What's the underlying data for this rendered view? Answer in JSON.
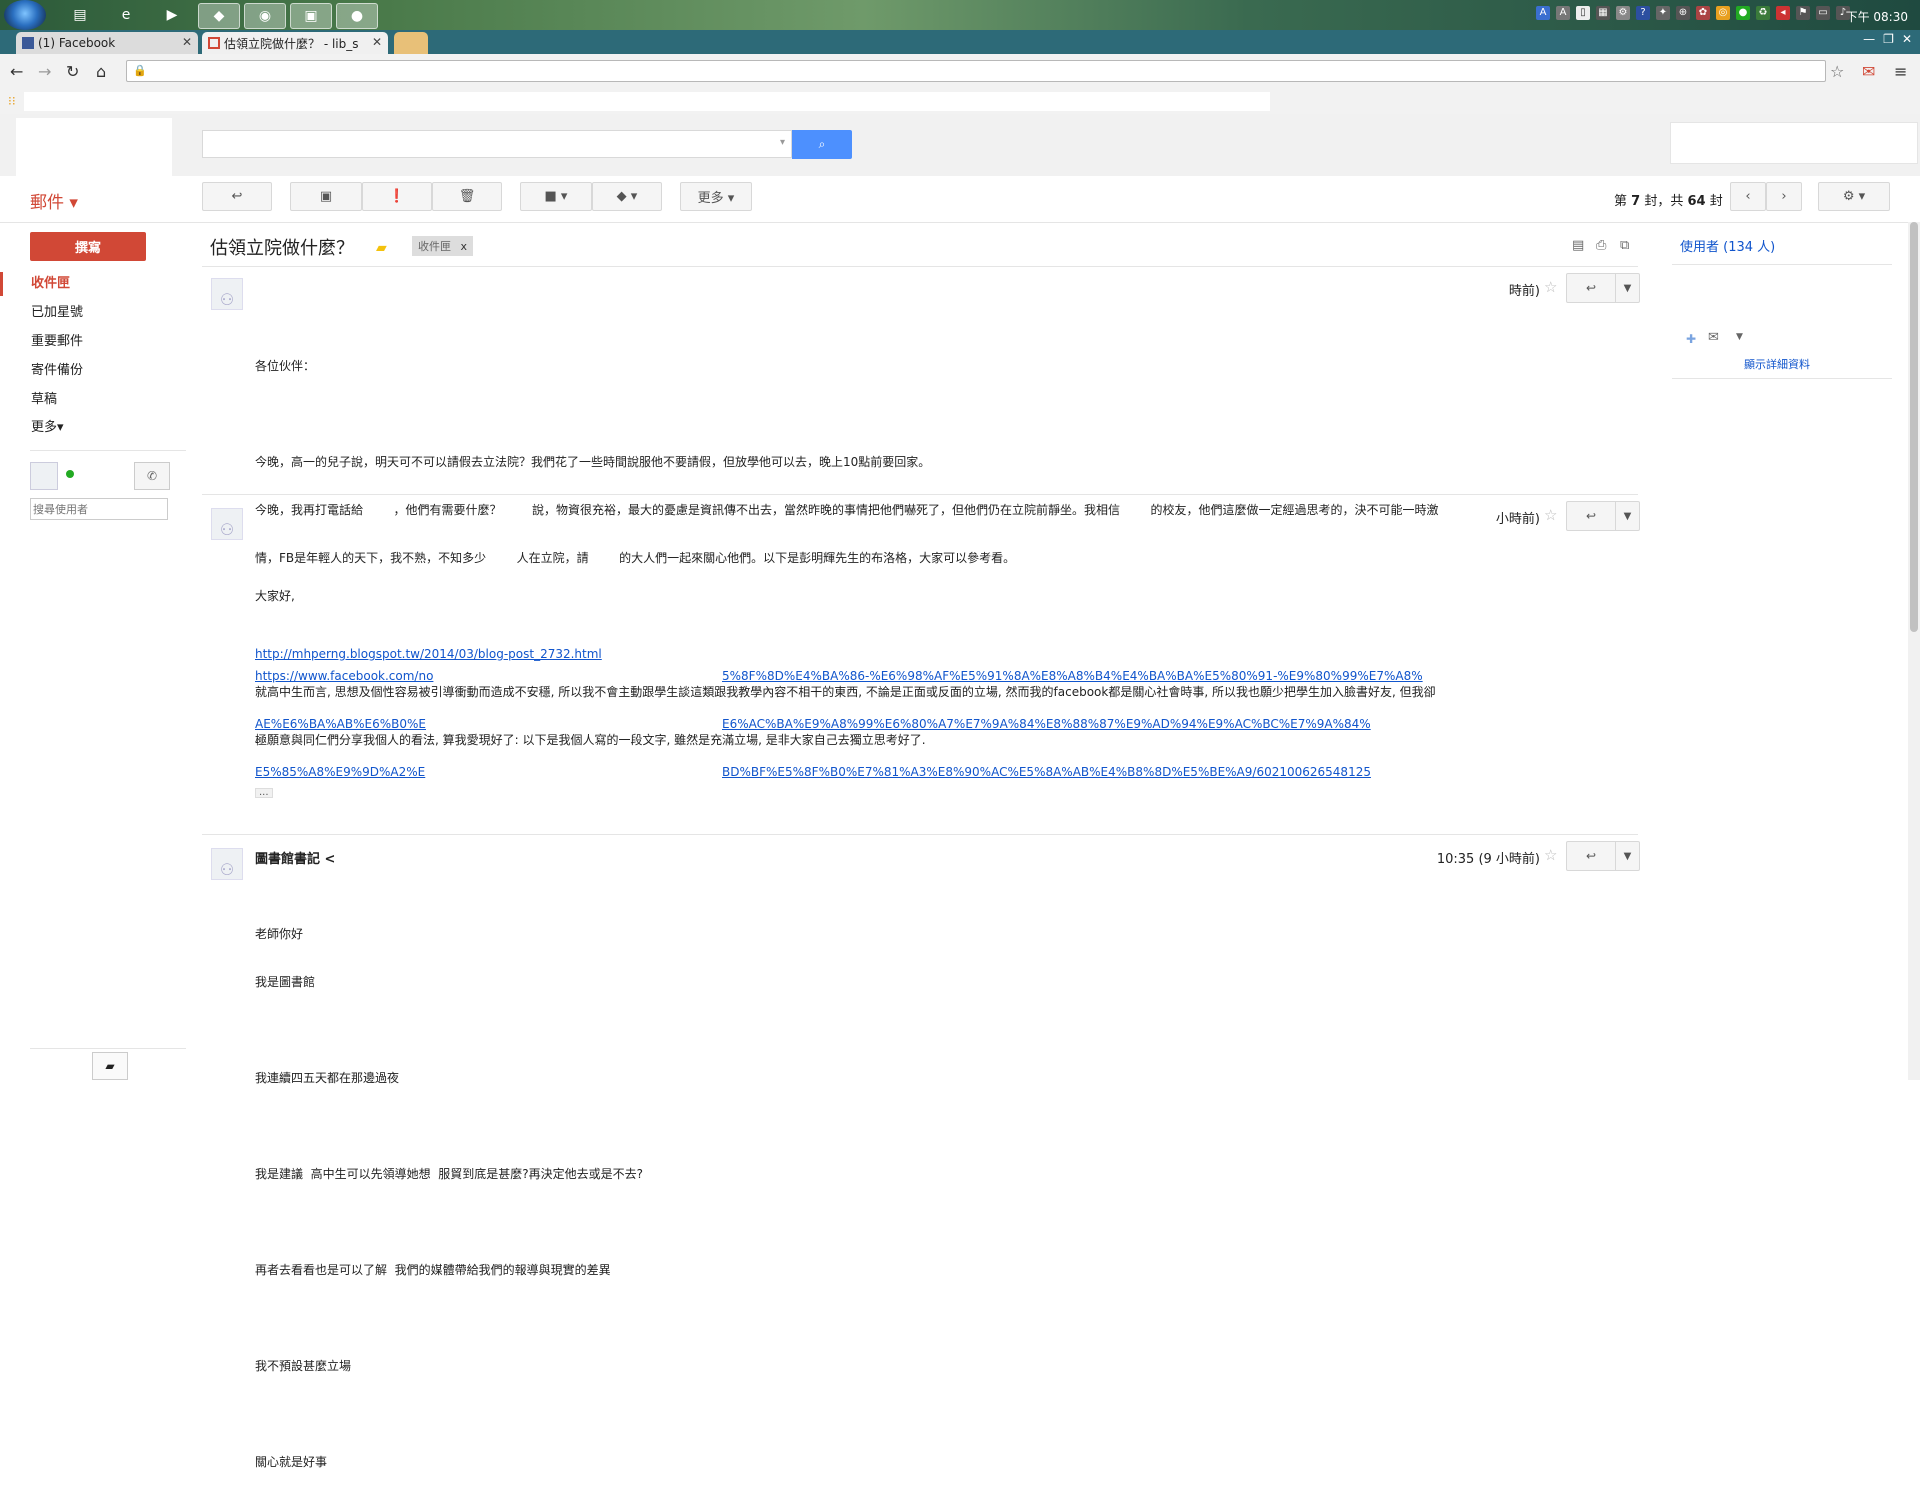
{
  "taskbar": {
    "clock": "下午 08:30"
  },
  "tabs": [
    {
      "label": "(1) Facebook",
      "active": false
    },
    {
      "label": "估領立院做什麼？ - lib_s",
      "active": true
    }
  ],
  "omnibox": {
    "value": ""
  },
  "gmail": {
    "mail_label": "郵件 ▾",
    "compose": "撰寫",
    "nav": [
      {
        "label": "收件匣",
        "active": true
      },
      {
        "label": "已加星號",
        "active": false
      },
      {
        "label": "重要郵件",
        "active": false
      },
      {
        "label": "寄件備份",
        "active": false
      },
      {
        "label": "草稿",
        "active": false
      },
      {
        "label": "更多▾",
        "active": false
      }
    ],
    "search_people_placeholder": "搜尋使用者",
    "toolbar": {
      "more_label": "更多 ▾",
      "pager_prefix": "第",
      "pager_current": "7",
      "pager_mid": "封，共",
      "pager_total": "64",
      "pager_suffix": "封"
    },
    "thread": {
      "subject": "估領立院做什麼？",
      "label_chip": "收件匣",
      "label_chip_close": "x"
    },
    "messages": [
      {
        "time": "時前)",
        "lines": [
          "各位伙伴：",
          "",
          "今晚，高一的兒子說，明天可不可以請假去立法院？我們花了一些時間說服他不要請假，但放學他可以去，晚上10點前要回家。",
          "今晚，我再打電話給        ，他們有需要什麼？        說，物資很充裕，最大的憂慮是資訊傳不出去，當然昨晚的事情把他們嚇死了，但他們仍在立院前靜坐。我相信        的校友，他們這麼做一定經過思考的，決不可能一時激",
          "情，FB是年輕人的天下，我不熟，不知多少        人在立院，請        的大人們一起來關心他們。以下是彭明輝先生的布洛格，大家可以參考看。"
        ],
        "link": "http://mhperng.blogspot.tw/2014/03/blog-post_2732.html",
        "tail": "-"
      },
      {
        "time": "小時前)",
        "lines": [
          "大家好,",
          "",
          "就高中生而言, 思想及個性容易被引導衝動而造成不安穩, 所以我不會主動跟學生談這類跟我教學內容不相干的東西, 不論是正面或反面的立場, 然而我的facebook都是關心社會時事, 所以我也願少把學生加入臉書好友, 但我卻",
          "極願意與同仁們分享我個人的看法, 算我愛現好了: 以下是我個人寫的一段文字, 雖然是充滿立場, 是非大家自己去獨立思考好了."
        ],
        "link_a": [
          "https://www.facebook.com/no",
          "AE%E6%BA%AB%E6%B0%E",
          "E5%85%A8%E9%9D%A2%E"
        ],
        "link_b": [
          "5%8F%8D%E4%BA%86-%E6%98%AF%E5%91%8A%E8%A8%B4%E4%BA%BA%E5%80%91-%E9%80%99%E7%A8%",
          "E6%AC%BA%E9%A8%99%E6%80%A7%E7%9A%84%E8%88%87%E9%AD%94%E9%AC%BC%E7%9A%84%",
          "BD%BF%E5%8F%B0%E7%81%A3%E8%90%AC%E5%8A%AB%E4%B8%8D%E5%BE%A9/602100626548125"
        ],
        "ellipsis": "..."
      },
      {
        "sender": "圖書館書記 <",
        "time": "10:35 (9 小時前)",
        "lines": [
          "老師你好",
          "我是圖書館",
          "",
          "我連續四五天都在那邊過夜",
          "",
          "我是建議  高中生可以先領導她想  服貿到底是甚麼?再決定他去或是不去?",
          "",
          "再者去看看也是可以了解  我們的媒體帶給我們的報導與現實的差異",
          "",
          "我不預設甚麼立場",
          "",
          "關心就是好事"
        ]
      }
    ],
    "right_panel": {
      "people": "使用者 (134 人)",
      "details": "顯示詳細資料"
    }
  }
}
